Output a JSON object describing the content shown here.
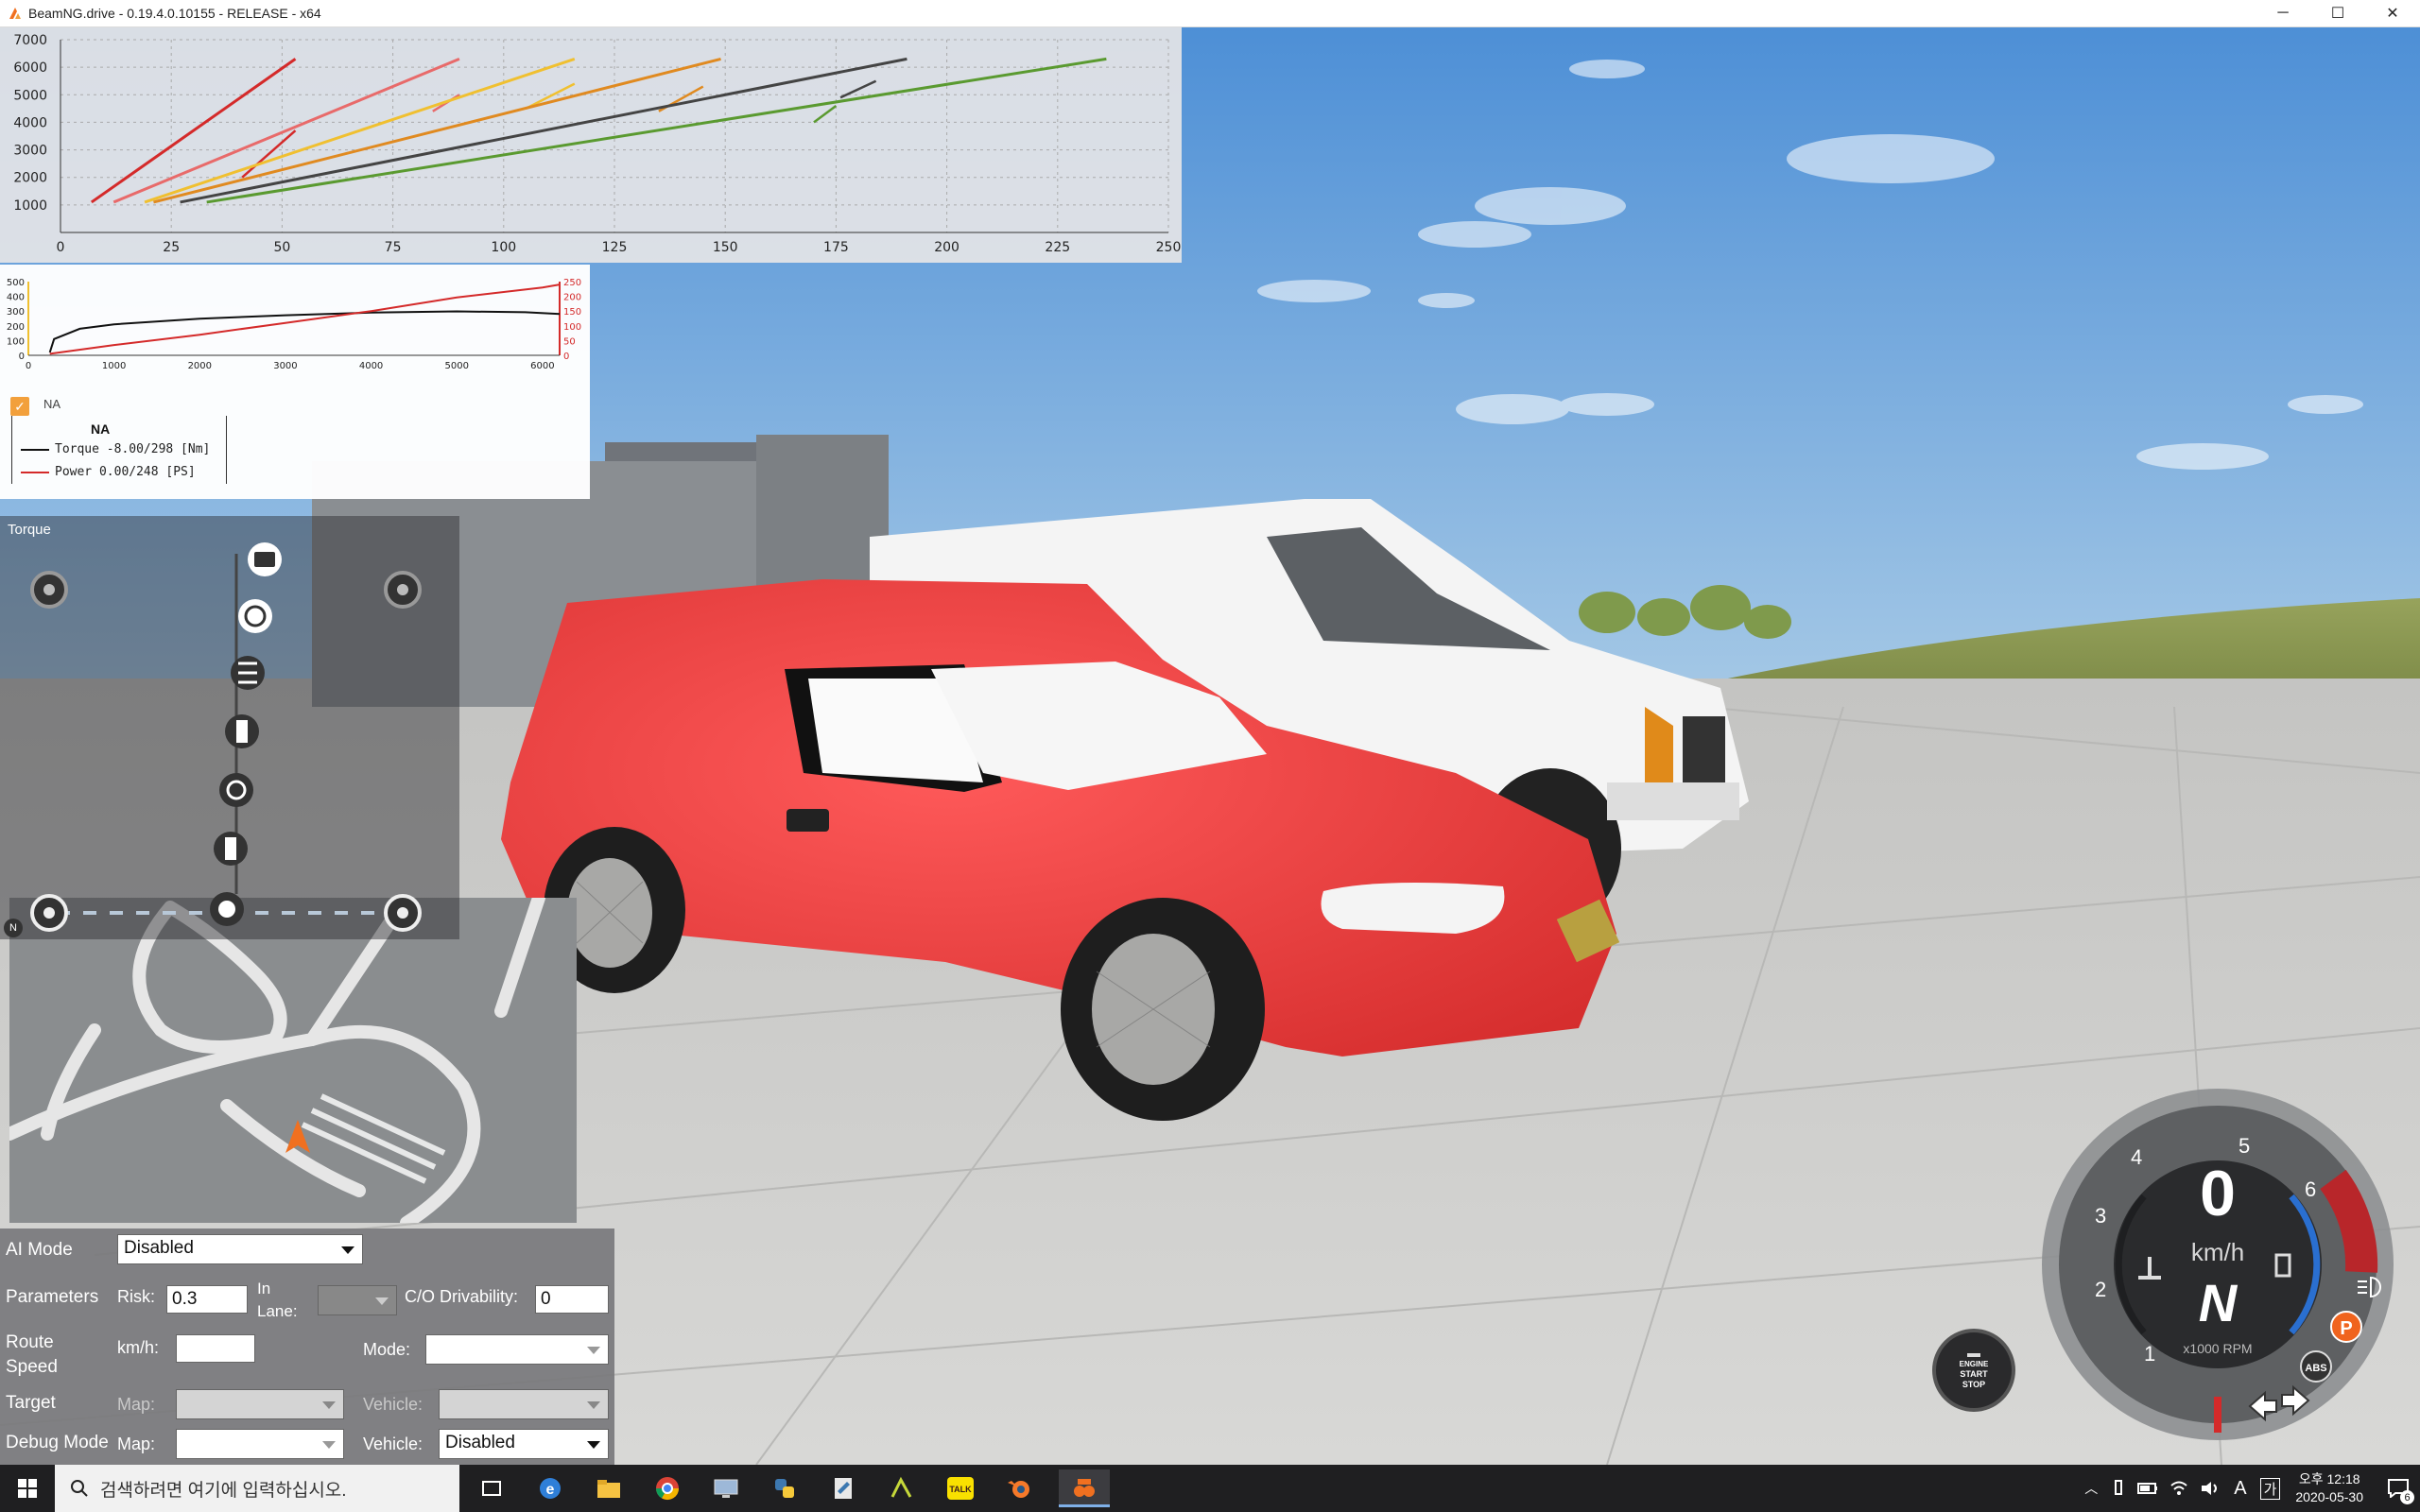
{
  "window": {
    "title": "BeamNG.drive - 0.19.4.0.10155 - RELEASE - x64",
    "minimize": "─",
    "maximize": "☐",
    "close": "✕"
  },
  "gear_chart": {
    "y_ticks": [
      "7000",
      "6000",
      "5000",
      "4000",
      "3000",
      "2000",
      "1000"
    ],
    "x_ticks": [
      "0",
      "25",
      "50",
      "75",
      "100",
      "125",
      "150",
      "175",
      "200",
      "225",
      "250"
    ]
  },
  "chart_data": [
    {
      "type": "line",
      "xlim": [
        0,
        250
      ],
      "ylim": [
        0,
        7000
      ],
      "grid": true,
      "series": [
        {
          "color": "#d42a2a",
          "points": [
            [
              7,
              1100
            ],
            [
              53,
              6300
            ]
          ],
          "shift": [
            [
              41,
              2000
            ],
            [
              53,
              3700
            ]
          ]
        },
        {
          "color": "#e86a6a",
          "points": [
            [
              12,
              1100
            ],
            [
              90,
              6300
            ]
          ],
          "shift": [
            [
              84,
              4400
            ],
            [
              90,
              5000
            ]
          ]
        },
        {
          "color": "#f0c030",
          "points": [
            [
              19,
              1100
            ],
            [
              116,
              6300
            ]
          ],
          "shift": [
            [
              105,
              4500
            ],
            [
              116,
              5400
            ]
          ]
        },
        {
          "color": "#e08a20",
          "points": [
            [
              21,
              1100
            ],
            [
              149,
              6300
            ]
          ],
          "shift": [
            [
              135,
              4400
            ],
            [
              145,
              5300
            ]
          ]
        },
        {
          "color": "#444444",
          "points": [
            [
              27,
              1100
            ],
            [
              191,
              6300
            ]
          ],
          "shift": [
            [
              176,
              4900
            ],
            [
              184,
              5500
            ]
          ]
        },
        {
          "color": "#5a9a30",
          "points": [
            [
              33,
              1100
            ],
            [
              236,
              6300
            ]
          ],
          "shift": [
            [
              170,
              4000
            ],
            [
              175,
              4600
            ]
          ]
        }
      ]
    },
    {
      "type": "line",
      "xlim": [
        0,
        6200
      ],
      "ylim_left": [
        0,
        500
      ],
      "ylim_right": [
        0,
        250
      ],
      "x_ticks": [
        "0",
        "1000",
        "2000",
        "3000",
        "4000",
        "5000",
        "6000"
      ],
      "y_ticks_left": [
        "500",
        "400",
        "300",
        "200",
        "100",
        "0"
      ],
      "y_ticks_right": [
        "250",
        "200",
        "150",
        "100",
        "50",
        "0"
      ],
      "series": [
        {
          "name": "Torque",
          "color": "#111111",
          "axis": "left",
          "points": [
            [
              250,
              20
            ],
            [
              300,
              110
            ],
            [
              600,
              180
            ],
            [
              1000,
              210
            ],
            [
              2000,
              248
            ],
            [
              3000,
              272
            ],
            [
              4000,
              290
            ],
            [
              5000,
              298
            ],
            [
              5800,
              292
            ],
            [
              6200,
              280
            ]
          ]
        },
        {
          "name": "Power",
          "color": "#d42a2a",
          "axis": "right",
          "points": [
            [
              250,
              5
            ],
            [
              1000,
              35
            ],
            [
              2000,
              70
            ],
            [
              3000,
              110
            ],
            [
              4000,
              150
            ],
            [
              5000,
              196
            ],
            [
              6000,
              230
            ],
            [
              6200,
              240
            ]
          ]
        }
      ]
    }
  ],
  "engine_chart": {
    "checkbox_label": "NA",
    "legend_title": "NA",
    "torque_label": "Torque -8.00/298 [Nm]",
    "power_label": "Power  0.00/248  [PS]"
  },
  "drivetrain": {
    "title": "Torque"
  },
  "minimap": {
    "north": "N"
  },
  "ai": {
    "mode_label": "AI Mode",
    "mode_value": "Disabled",
    "parameters_label": "Parameters",
    "risk_label": "Risk:",
    "risk_value": "0.3",
    "in_lane_label_1": "In",
    "in_lane_label_2": "Lane:",
    "co_label": "C/O Drivability:",
    "co_value": "0",
    "route_label_1": "Route",
    "route_label_2": "Speed",
    "kmh_label": "km/h:",
    "mode2_label": "Mode:",
    "target_label": "Target",
    "map_label": "Map:",
    "vehicle_label": "Vehicle:",
    "debug_label": "Debug Mode",
    "debug_map_label": "Map:",
    "debug_vehicle_label": "Vehicle:",
    "debug_vehicle_value": "Disabled"
  },
  "engine_button": {
    "line1": "ENGINE",
    "line2": "START",
    "line3": "STOP"
  },
  "gauge": {
    "ticks": [
      "1",
      "2",
      "3",
      "4",
      "5",
      "6"
    ],
    "unit": "km/h",
    "speed": "0",
    "gear": "N",
    "rpm_unit": "x1000 RPM",
    "parking": "P",
    "abs": "ABS"
  },
  "taskbar": {
    "search_placeholder": "검색하려면 여기에 입력하십시오.",
    "time": "오후 12:18",
    "date": "2020-05-30",
    "ime": "A",
    "lang": "가",
    "notif_count": "6"
  },
  "colors": {
    "gear1": "#d42a2a",
    "gear2": "#e86a6a",
    "gear3": "#f0c030",
    "gear4": "#e08a20",
    "gear5": "#444444",
    "gear6": "#5a9a30",
    "gauge_blue": "#2a6fd0",
    "gauge_red": "#b8262a",
    "parking_orange": "#f0641e"
  }
}
